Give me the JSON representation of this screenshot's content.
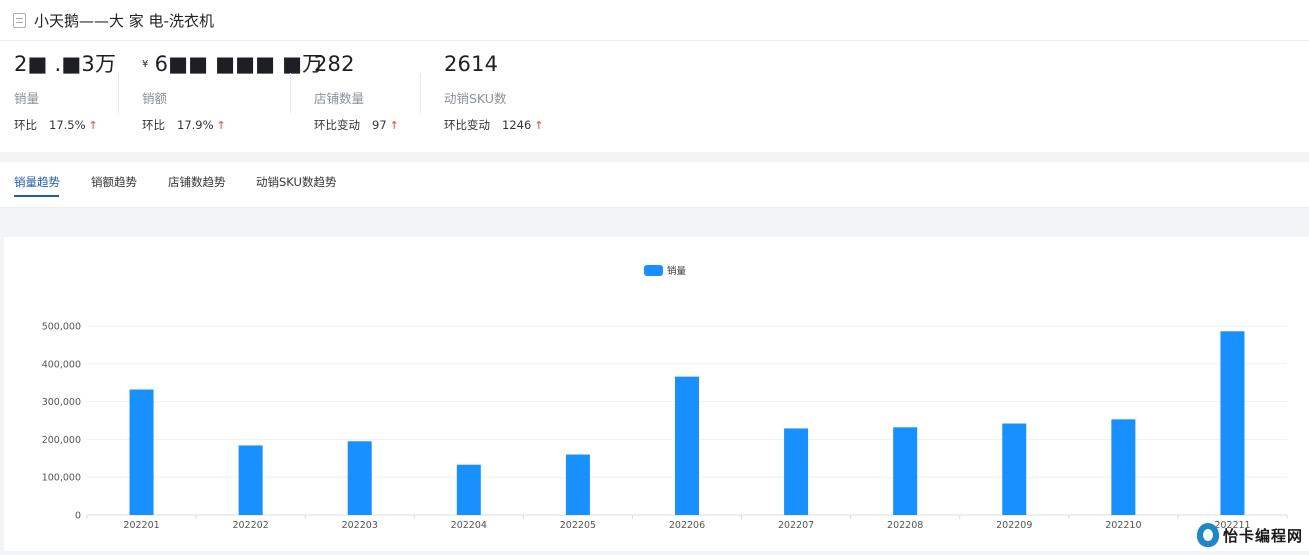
{
  "page": {
    "title": "小天鹅——大 家 电-洗衣机"
  },
  "stats": [
    {
      "value": "2■ .■3万",
      "currency": "",
      "label": "销量",
      "change_label": "环比",
      "change_value": "17.5%",
      "trend": "up"
    },
    {
      "value": "6■■ ■■■ ■万",
      "currency": "¥",
      "label": "销额",
      "change_label": "环比",
      "change_value": "17.9%",
      "trend": "up"
    },
    {
      "value": "282",
      "currency": "",
      "label": "店铺数量",
      "change_label": "环比变动",
      "change_value": "97",
      "trend": "up"
    },
    {
      "value": "2614",
      "currency": "",
      "label": "动销SKU数",
      "change_label": "环比变动",
      "change_value": "1246",
      "trend": "up"
    }
  ],
  "tabs": [
    {
      "label": "销量趋势",
      "active": true
    },
    {
      "label": "销额趋势",
      "active": false
    },
    {
      "label": "店铺数趋势",
      "active": false
    },
    {
      "label": "动销SKU数趋势",
      "active": false
    }
  ],
  "colors": {
    "bar": "#1890ff",
    "accent": "#1e5db0",
    "up_arrow": "#e8453c"
  },
  "icons": {
    "title": "document-icon",
    "trend_up": "arrow-up-icon"
  },
  "chart_data": {
    "type": "bar",
    "legend": "销量",
    "legend_position": "top-center",
    "grid": true,
    "categories": [
      "202201",
      "202202",
      "202203",
      "202204",
      "202205",
      "202206",
      "202207",
      "202208",
      "202209",
      "202210",
      "202211"
    ],
    "series": [
      {
        "name": "销量",
        "values": [
          332000,
          184000,
          195000,
          133000,
          160000,
          366000,
          229000,
          232000,
          242000,
          253000,
          486000
        ]
      }
    ],
    "ylim": [
      0,
      500000
    ],
    "yticks": [
      0,
      100000,
      200000,
      300000,
      400000,
      500000
    ],
    "ytick_labels": [
      "0",
      "100,000",
      "200,000",
      "300,000",
      "400,000",
      "500,000"
    ]
  },
  "watermark": {
    "text": "怡卡编程网"
  }
}
